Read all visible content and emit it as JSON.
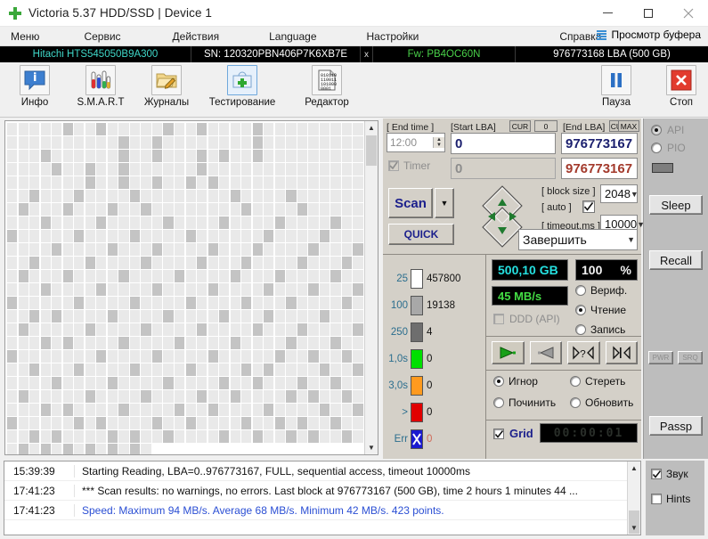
{
  "window": {
    "title": "Victoria 5.37 HDD/SSD | Device 1",
    "icon": "cross-medical-icon",
    "minimize": "–",
    "maximize": "□",
    "close": "✕"
  },
  "menu": {
    "items": [
      {
        "label": "Меню",
        "name": "menu-item-menu"
      },
      {
        "label": "Сервис",
        "name": "menu-item-service"
      },
      {
        "label": "Действия",
        "name": "menu-item-actions"
      },
      {
        "label": "Language",
        "name": "menu-item-language"
      },
      {
        "label": "Настройки",
        "name": "menu-item-settings"
      },
      {
        "label": "Справка",
        "name": "menu-item-help"
      }
    ],
    "buffer_button": "Просмотр буфера"
  },
  "device": {
    "model": "Hitachi HTS545050B9A300",
    "serial": "SN: 120320PBN406P7K6XB7E",
    "close_mark": "x",
    "firmware": "Fw: PB4OC60N",
    "capacity": "976773168 LBA (500 GB)",
    "model_color": "#3fd7c8",
    "fw_color": "#49d049"
  },
  "toolbar": {
    "items": [
      {
        "label": "Инфо",
        "icon": "info-icon",
        "selected": false
      },
      {
        "label": "S.M.A.R.T",
        "icon": "test-tubes-icon",
        "selected": false
      },
      {
        "label": "Журналы",
        "icon": "folder-pencil-icon",
        "selected": false
      },
      {
        "label": "Тестирование",
        "icon": "first-aid-icon",
        "selected": true
      },
      {
        "label": "Редактор",
        "icon": "binary-document-icon",
        "selected": false
      }
    ],
    "pause": {
      "label": "Пауза",
      "icon": "pause-icon"
    },
    "stop": {
      "label": "Стоп",
      "icon": "stop-x-icon"
    }
  },
  "scan": {
    "end_time_label": "[ End time ]",
    "end_time_value": "12:00",
    "timer_label": "Timer",
    "timer_checked": true,
    "start_lba_label": "[Start LBA]",
    "start_lba_cur": "CUR",
    "start_lba_cur_value": "0",
    "start_lba_value": "0",
    "start_lba_second": "0",
    "end_lba_label": "[End LBA]",
    "end_lba_cur": "CUR",
    "end_lba_max": "MAX",
    "end_lba_value": "976773167",
    "end_lba_second": "976773167",
    "scan_button": "Scan",
    "scan_dropdown": "▼",
    "quick_button": "QUICK",
    "nav_up": "▲",
    "nav_down": "▼",
    "nav_left": "◄",
    "nav_right": "►",
    "block_size_label": "[ block size ]",
    "auto_label": "[ auto ]",
    "auto_checked": true,
    "block_size_value": "2048",
    "timeout_label": "[ timeout,ms ]",
    "timeout_value": "10000",
    "finish_action": "Завершить"
  },
  "legend": {
    "rows": [
      {
        "threshold": "25",
        "count": "457800",
        "color": "#ffffff",
        "name": "legend-25ms"
      },
      {
        "threshold": "100",
        "count": "19138",
        "color": "#a8a8a8",
        "name": "legend-100ms"
      },
      {
        "threshold": "250",
        "count": "4",
        "color": "#6e6e6e",
        "name": "legend-250ms"
      },
      {
        "threshold": "1,0s",
        "count": "0",
        "color": "#00e000",
        "name": "legend-1s"
      },
      {
        "threshold": "3,0s",
        "count": "0",
        "color": "#ff9a1e",
        "name": "legend-3s"
      },
      {
        "threshold": ">",
        "count": "0",
        "color": "#e00000",
        "name": "legend-over"
      },
      {
        "threshold": "Err",
        "count": "0",
        "color": "#1a1ad0",
        "name": "legend-errors"
      }
    ]
  },
  "status": {
    "capacity_led": "500,10 GB",
    "percent_led": "100",
    "percent_sign": "%",
    "speed_led": "45 MB/s",
    "ddd_label": "DDD (API)",
    "ddd_checked": false,
    "modes": [
      {
        "label": "Вериф.",
        "selected": false,
        "name": "radio-verify"
      },
      {
        "label": "Чтение",
        "selected": true,
        "name": "radio-read"
      },
      {
        "label": "Запись",
        "selected": false,
        "name": "radio-write"
      }
    ],
    "transport": [
      {
        "icon": "play-forward-icon",
        "name": "play-forward-button",
        "active": true
      },
      {
        "icon": "play-reverse-icon",
        "name": "play-reverse-button",
        "active": false
      },
      {
        "icon": "seek-random-icon",
        "name": "seek-random-button",
        "active": false
      },
      {
        "icon": "skip-start-icon",
        "name": "skip-start-button",
        "active": false
      }
    ],
    "defects": [
      {
        "label": "Игнор",
        "selected": true,
        "name": "radio-ignore"
      },
      {
        "label": "Стереть",
        "selected": false,
        "name": "radio-erase"
      },
      {
        "label": "Починить",
        "selected": false,
        "name": "radio-repair"
      },
      {
        "label": "Обновить",
        "selected": false,
        "name": "radio-refresh"
      }
    ],
    "grid_label": "Grid",
    "grid_checked": true,
    "elapsed": "00:00:01"
  },
  "sidebar": {
    "api_label": "API",
    "api_selected": true,
    "pio_label": "PIO",
    "pio_selected": false,
    "sleep": "Sleep",
    "recall": "Recall",
    "small_left": "PWR",
    "small_right": "SRQ",
    "passp": "Passp"
  },
  "log": {
    "entries": [
      {
        "time": "15:39:39",
        "text": "Starting Reading, LBA=0..976773167, FULL, sequential access, timeout 10000ms",
        "color": "black"
      },
      {
        "time": "17:41:23",
        "text": "*** Scan results: no warnings, no errors. Last block at 976773167 (500 GB), time 2 hours 1 minutes 44 ...",
        "color": "black"
      },
      {
        "time": "17:41:23",
        "text": "Speed: Maximum 94 MB/s. Average 68 MB/s. Minimum 42 MB/s. 423 points.",
        "color": "blue"
      }
    ],
    "sound_label": "Звук",
    "sound_checked": true,
    "hints_label": "Hints",
    "hints_checked": false
  },
  "map": {
    "columns": 32,
    "rows": 25,
    "last_row_filled": 13,
    "light_color": "#e9e9e9",
    "dark_color": "#c4c4c4",
    "dark_cells": [
      [
        0,
        5
      ],
      [
        0,
        8
      ],
      [
        0,
        14
      ],
      [
        0,
        17
      ],
      [
        0,
        22
      ],
      [
        1,
        10
      ],
      [
        1,
        13
      ],
      [
        1,
        22
      ],
      [
        2,
        3
      ],
      [
        2,
        10
      ],
      [
        2,
        13
      ],
      [
        2,
        17
      ],
      [
        2,
        19
      ],
      [
        2,
        22
      ],
      [
        3,
        4
      ],
      [
        3,
        7
      ],
      [
        3,
        10
      ],
      [
        3,
        17
      ],
      [
        4,
        7
      ],
      [
        4,
        10
      ],
      [
        4,
        13
      ],
      [
        4,
        16
      ],
      [
        4,
        18
      ],
      [
        5,
        2
      ],
      [
        5,
        6
      ],
      [
        5,
        11
      ],
      [
        5,
        20
      ],
      [
        5,
        25
      ],
      [
        6,
        1
      ],
      [
        6,
        5
      ],
      [
        6,
        9
      ],
      [
        6,
        12
      ],
      [
        6,
        21
      ],
      [
        6,
        26
      ],
      [
        7,
        3
      ],
      [
        7,
        8
      ],
      [
        7,
        14
      ],
      [
        7,
        19
      ],
      [
        7,
        24
      ],
      [
        7,
        29
      ],
      [
        8,
        0
      ],
      [
        8,
        6
      ],
      [
        8,
        11
      ],
      [
        8,
        16
      ],
      [
        8,
        23
      ],
      [
        8,
        28
      ],
      [
        9,
        4
      ],
      [
        9,
        9
      ],
      [
        9,
        13
      ],
      [
        9,
        18
      ],
      [
        9,
        22
      ],
      [
        9,
        27
      ],
      [
        9,
        31
      ],
      [
        10,
        2
      ],
      [
        10,
        7
      ],
      [
        10,
        12
      ],
      [
        10,
        17
      ],
      [
        10,
        21
      ],
      [
        10,
        26
      ],
      [
        10,
        30
      ],
      [
        11,
        1
      ],
      [
        11,
        5
      ],
      [
        11,
        10
      ],
      [
        11,
        15
      ],
      [
        11,
        20
      ],
      [
        11,
        24
      ],
      [
        11,
        29
      ],
      [
        12,
        3
      ],
      [
        12,
        8
      ],
      [
        12,
        13
      ],
      [
        12,
        18
      ],
      [
        12,
        23
      ],
      [
        12,
        27
      ],
      [
        12,
        31
      ],
      [
        13,
        0
      ],
      [
        13,
        6
      ],
      [
        13,
        11
      ],
      [
        13,
        16
      ],
      [
        13,
        21
      ],
      [
        13,
        25
      ],
      [
        13,
        30
      ],
      [
        14,
        2
      ],
      [
        14,
        4
      ],
      [
        14,
        9
      ],
      [
        14,
        14
      ],
      [
        14,
        19
      ],
      [
        14,
        23
      ],
      [
        14,
        28
      ],
      [
        15,
        1
      ],
      [
        15,
        7
      ],
      [
        15,
        12
      ],
      [
        15,
        17
      ],
      [
        15,
        22
      ],
      [
        15,
        26
      ],
      [
        15,
        31
      ],
      [
        16,
        3
      ],
      [
        16,
        5
      ],
      [
        16,
        10
      ],
      [
        16,
        15
      ],
      [
        16,
        20
      ],
      [
        16,
        25
      ],
      [
        16,
        29
      ],
      [
        17,
        0
      ],
      [
        17,
        8
      ],
      [
        17,
        13
      ],
      [
        17,
        18
      ],
      [
        17,
        24
      ],
      [
        17,
        27
      ],
      [
        17,
        30
      ],
      [
        18,
        2
      ],
      [
        18,
        6
      ],
      [
        18,
        11
      ],
      [
        18,
        16
      ],
      [
        18,
        21
      ],
      [
        18,
        23
      ],
      [
        18,
        28
      ],
      [
        18,
        31
      ],
      [
        19,
        4
      ],
      [
        19,
        9
      ],
      [
        19,
        14
      ],
      [
        19,
        19
      ],
      [
        19,
        22
      ],
      [
        19,
        26
      ],
      [
        19,
        29
      ],
      [
        20,
        1
      ],
      [
        20,
        7
      ],
      [
        20,
        12
      ],
      [
        20,
        17
      ],
      [
        20,
        20
      ],
      [
        20,
        25
      ],
      [
        20,
        27
      ],
      [
        20,
        30
      ],
      [
        21,
        3
      ],
      [
        21,
        5
      ],
      [
        21,
        10
      ],
      [
        21,
        15
      ],
      [
        21,
        18
      ],
      [
        21,
        23
      ],
      [
        21,
        28
      ],
      [
        21,
        31
      ],
      [
        22,
        0
      ],
      [
        22,
        6
      ],
      [
        22,
        8
      ],
      [
        22,
        13
      ],
      [
        22,
        16
      ],
      [
        22,
        21
      ],
      [
        22,
        24
      ],
      [
        22,
        26
      ],
      [
        22,
        29
      ],
      [
        23,
        2
      ],
      [
        23,
        4
      ],
      [
        23,
        9
      ],
      [
        23,
        11
      ],
      [
        23,
        14
      ],
      [
        23,
        19
      ],
      [
        23,
        22
      ],
      [
        23,
        25
      ],
      [
        23,
        27
      ],
      [
        23,
        30
      ],
      [
        24,
        1
      ],
      [
        24,
        3
      ],
      [
        24,
        5
      ],
      [
        24,
        7
      ],
      [
        24,
        9
      ],
      [
        24,
        11
      ]
    ]
  }
}
